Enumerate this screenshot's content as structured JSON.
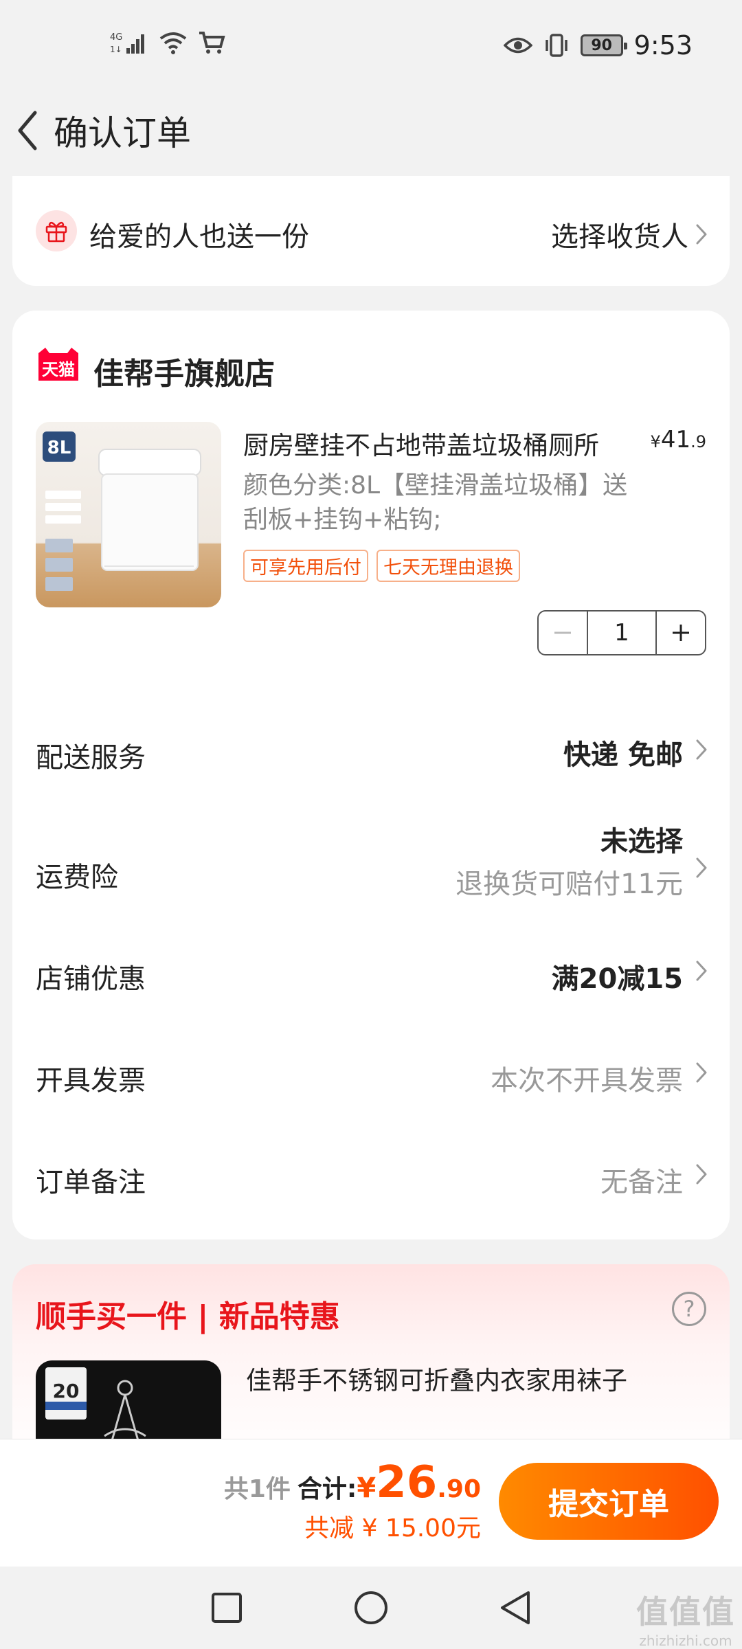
{
  "status_bar": {
    "network": "4G",
    "battery": "90",
    "time": "9:53"
  },
  "header": {
    "title": "确认订单"
  },
  "gift": {
    "label": "给爱的人也送一份",
    "action": "选择收货人"
  },
  "shop": {
    "badge": "天猫",
    "name": "佳帮手旗舰店"
  },
  "product": {
    "title": "厨房壁挂不占地带盖垃圾桶厕所",
    "price_currency": "¥",
    "price_int": "41",
    "price_dec": ".9",
    "sku": "颜色分类:8L【壁挂滑盖垃圾桶】送刮板+挂钩+粘钩;",
    "tags": [
      "可享先用后付",
      "七天无理由退换"
    ],
    "image_caption": "8L",
    "quantity": "1"
  },
  "rows": {
    "delivery": {
      "label": "配送服务",
      "value": "快递 免邮"
    },
    "insurance": {
      "label": "运费险",
      "value": "未选择",
      "sub": "退换货可赔付11元"
    },
    "coupon": {
      "label": "店铺优惠",
      "value": "满20减15"
    },
    "invoice": {
      "label": "开具发票",
      "value": "本次不开具发票"
    },
    "note": {
      "label": "订单备注",
      "value": "无备注"
    }
  },
  "recommend": {
    "title": "顺手买一件 | 新品特惠",
    "product_name": "佳帮手不锈钢可折叠内衣家用袜子",
    "image_badge": "20"
  },
  "bottom": {
    "count": "共1件",
    "sum_label": "合计:",
    "currency": "¥",
    "amount_int": "26",
    "amount_dec": ".90",
    "discount": "共减 ¥ 15.00元",
    "submit": "提交订单"
  },
  "watermark": {
    "logo": "值值值",
    "text": "zhizhizhi.com"
  },
  "colors": {
    "accent": "#ff5000",
    "recommend_title": "#e8151b",
    "tag_border": "#f7b08a"
  }
}
